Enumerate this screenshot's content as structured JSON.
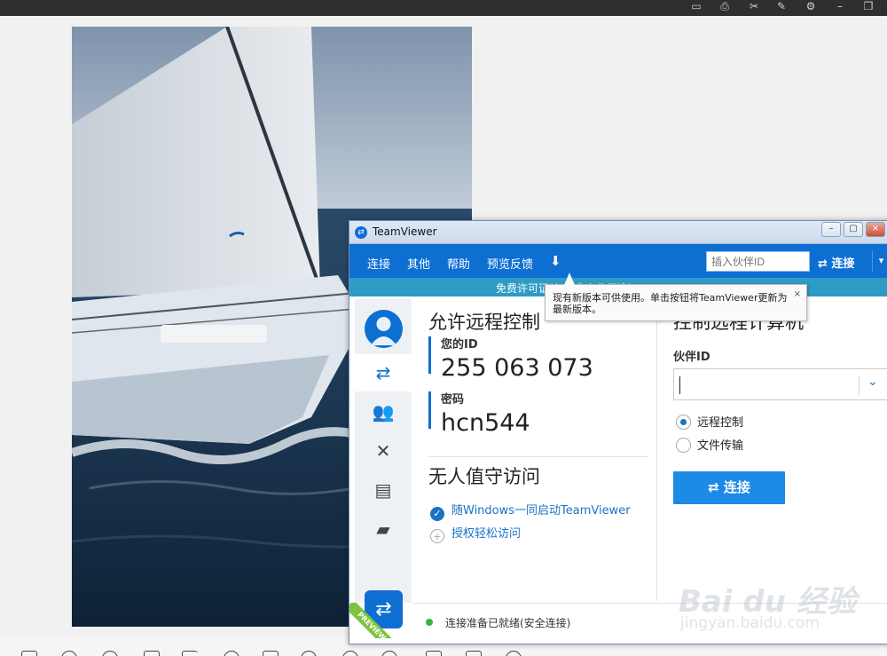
{
  "viewer": {
    "top_icons": [
      "save-icon",
      "print-icon",
      "cut-icon",
      "note-icon",
      "gear-icon",
      "minimize-icon",
      "restore-icon"
    ],
    "bottom_icons": [
      "fit-icon",
      "zoom-out-icon",
      "zoom-in-icon",
      "actual-size-icon",
      "prev-icon",
      "play-icon",
      "slideshow-icon",
      "next-icon",
      "rotate-left-icon",
      "rotate-right-icon",
      "delete-icon",
      "edit-icon",
      "info-icon"
    ]
  },
  "teamviewer": {
    "title": "TeamViewer",
    "menu": {
      "items": [
        "连接",
        "其他",
        "帮助",
        "预览反馈"
      ],
      "download_icon": "download-icon",
      "partner_placeholder": "插入伙伴ID",
      "connect_label": "⇄ 连接"
    },
    "license_bar": "免费许可证(仅限非商业用途)",
    "tooltip": {
      "text": "现有新版本可供使用。单击按钮将TeamViewer更新为最新版本。",
      "close": "×"
    },
    "sidebar": {
      "icons": [
        "remote-control-icon",
        "meeting-icon",
        "computers-contacts-icon",
        "contacts-book-icon",
        "chat-icon"
      ],
      "preview_badge": "PREVIEW"
    },
    "allow_remote": {
      "title": "允许远程控制",
      "your_id_label": "您的ID",
      "your_id": "255 063 073",
      "password_label": "密码",
      "password": "hcn544"
    },
    "unattended": {
      "title": "无人值守访问",
      "start_with_windows": "随Windows一同启动TeamViewer",
      "grant_easy_access": "授权轻松访问"
    },
    "control_remote": {
      "title": "控制远程计算机",
      "partner_id_label": "伙伴ID",
      "partner_id_value": "",
      "option_remote_control": "远程控制",
      "option_file_transfer": "文件传输",
      "connect_button": "⇄ 连接"
    },
    "status": {
      "text": "连接准备已就绪(安全连接)",
      "color": "#2fb84a"
    },
    "accent_color": "#0e6fd3"
  },
  "watermark": {
    "main": "Bai du 经验",
    "sub": "jingyan.baidu.com"
  }
}
